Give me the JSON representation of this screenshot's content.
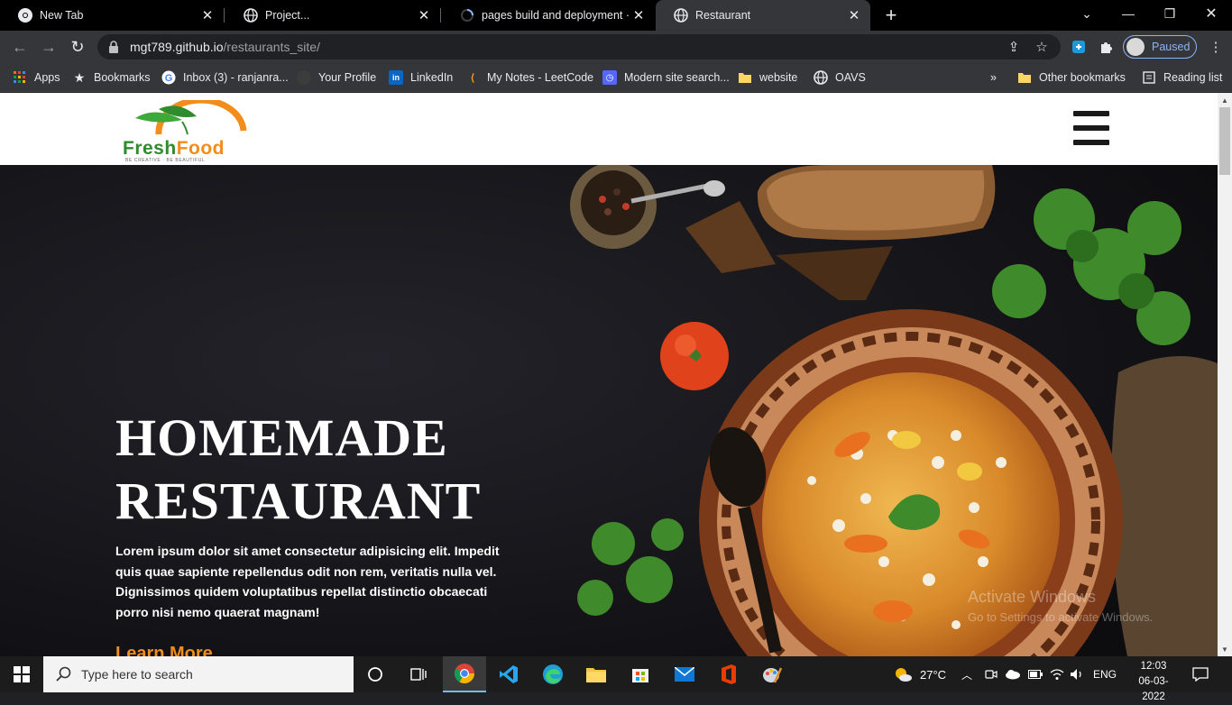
{
  "browser": {
    "tabs": [
      {
        "title": "New Tab",
        "active": false
      },
      {
        "title": "Project...",
        "active": false
      },
      {
        "title": "pages build and deployment · Mc",
        "active": false
      },
      {
        "title": "Restaurant",
        "active": true
      }
    ],
    "address": {
      "host": "mgt789.github.io",
      "path": "/restaurants_site/"
    },
    "profile_label": "Paused",
    "bookmarks": [
      {
        "label": "Apps",
        "icon": "apps-grid-icon"
      },
      {
        "label": "Bookmarks",
        "icon": "star-icon"
      },
      {
        "label": "Inbox (3) - ranjanra...",
        "icon": "google-icon"
      },
      {
        "label": "Your Profile",
        "icon": "github-icon"
      },
      {
        "label": "LinkedIn",
        "icon": "linkedin-icon"
      },
      {
        "label": "My Notes - LeetCode",
        "icon": "leetcode-icon"
      },
      {
        "label": "Modern site search...",
        "icon": "algolia-icon"
      },
      {
        "label": "website",
        "icon": "folder-icon"
      },
      {
        "label": "OAVS",
        "icon": "globe-icon"
      }
    ],
    "other_bookmarks": "Other bookmarks",
    "reading_list": "Reading list",
    "overflow": "»"
  },
  "site": {
    "logo": {
      "fresh": "Fresh",
      "food": "Food",
      "tagline": "BE CREATIVE · BE BEAUTIFUL"
    },
    "hero": {
      "title_line1": "HOMEMADE",
      "title_line2": "RESTAURANT",
      "text": "Lorem ipsum dolor sit amet consectetur adipisicing elit. Impedit quis quae sapiente repellendus odit non rem, veritatis nulla vel. Dignissimos quidem voluptatibus repellat distinctio obcaecati porro nisi nemo quaerat magnam!",
      "cta": "Learn More"
    },
    "watermark": {
      "line1": "Activate Windows",
      "line2": "Go to Settings to activate Windows."
    }
  },
  "taskbar": {
    "search_placeholder": "Type here to search",
    "weather": "27°C",
    "language": "ENG",
    "time": "12:03",
    "date": "06-03-2022"
  },
  "colors": {
    "accent": "#f28c1a",
    "brand_green": "#2e8b2e",
    "hero_bg": "#17171c"
  }
}
